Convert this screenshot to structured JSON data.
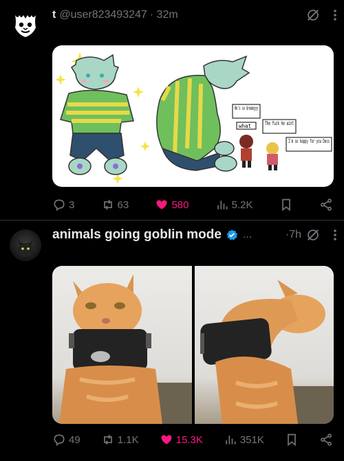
{
  "posts": [
    {
      "author_name": "t",
      "author_handle": "@user823493247",
      "time": "· 32m",
      "image_speech": [
        "He's so dreamyyy",
        "what",
        "The fuck he aint",
        "I'm so happy for you Dess"
      ],
      "actions": {
        "replies": "3",
        "reposts": "63",
        "likes": "580",
        "views": "5.2K"
      },
      "icons": [
        "avatar-mask-icon",
        "muted-icon",
        "more-icon",
        "reply-icon",
        "repost-icon",
        "like-icon",
        "views-icon",
        "bookmark-icon",
        "share-icon"
      ]
    },
    {
      "author_name": "animals going goblin mode",
      "verified_mark": "",
      "ellipsis": "...",
      "time": "·7h",
      "actions": {
        "replies": "49",
        "reposts": "1.1K",
        "likes": "15.3K",
        "views": "351K"
      },
      "icons": [
        "verified-icon",
        "muted-icon",
        "more-icon",
        "reply-icon",
        "repost-icon",
        "like-icon",
        "views-icon",
        "bookmark-icon",
        "share-icon"
      ]
    }
  ],
  "colors": {
    "background": "#000000",
    "text": "#e7e9ea",
    "muted": "#71767b",
    "like": "#f91880",
    "verified": "#1d9bf0",
    "divider": "#2f3336"
  }
}
